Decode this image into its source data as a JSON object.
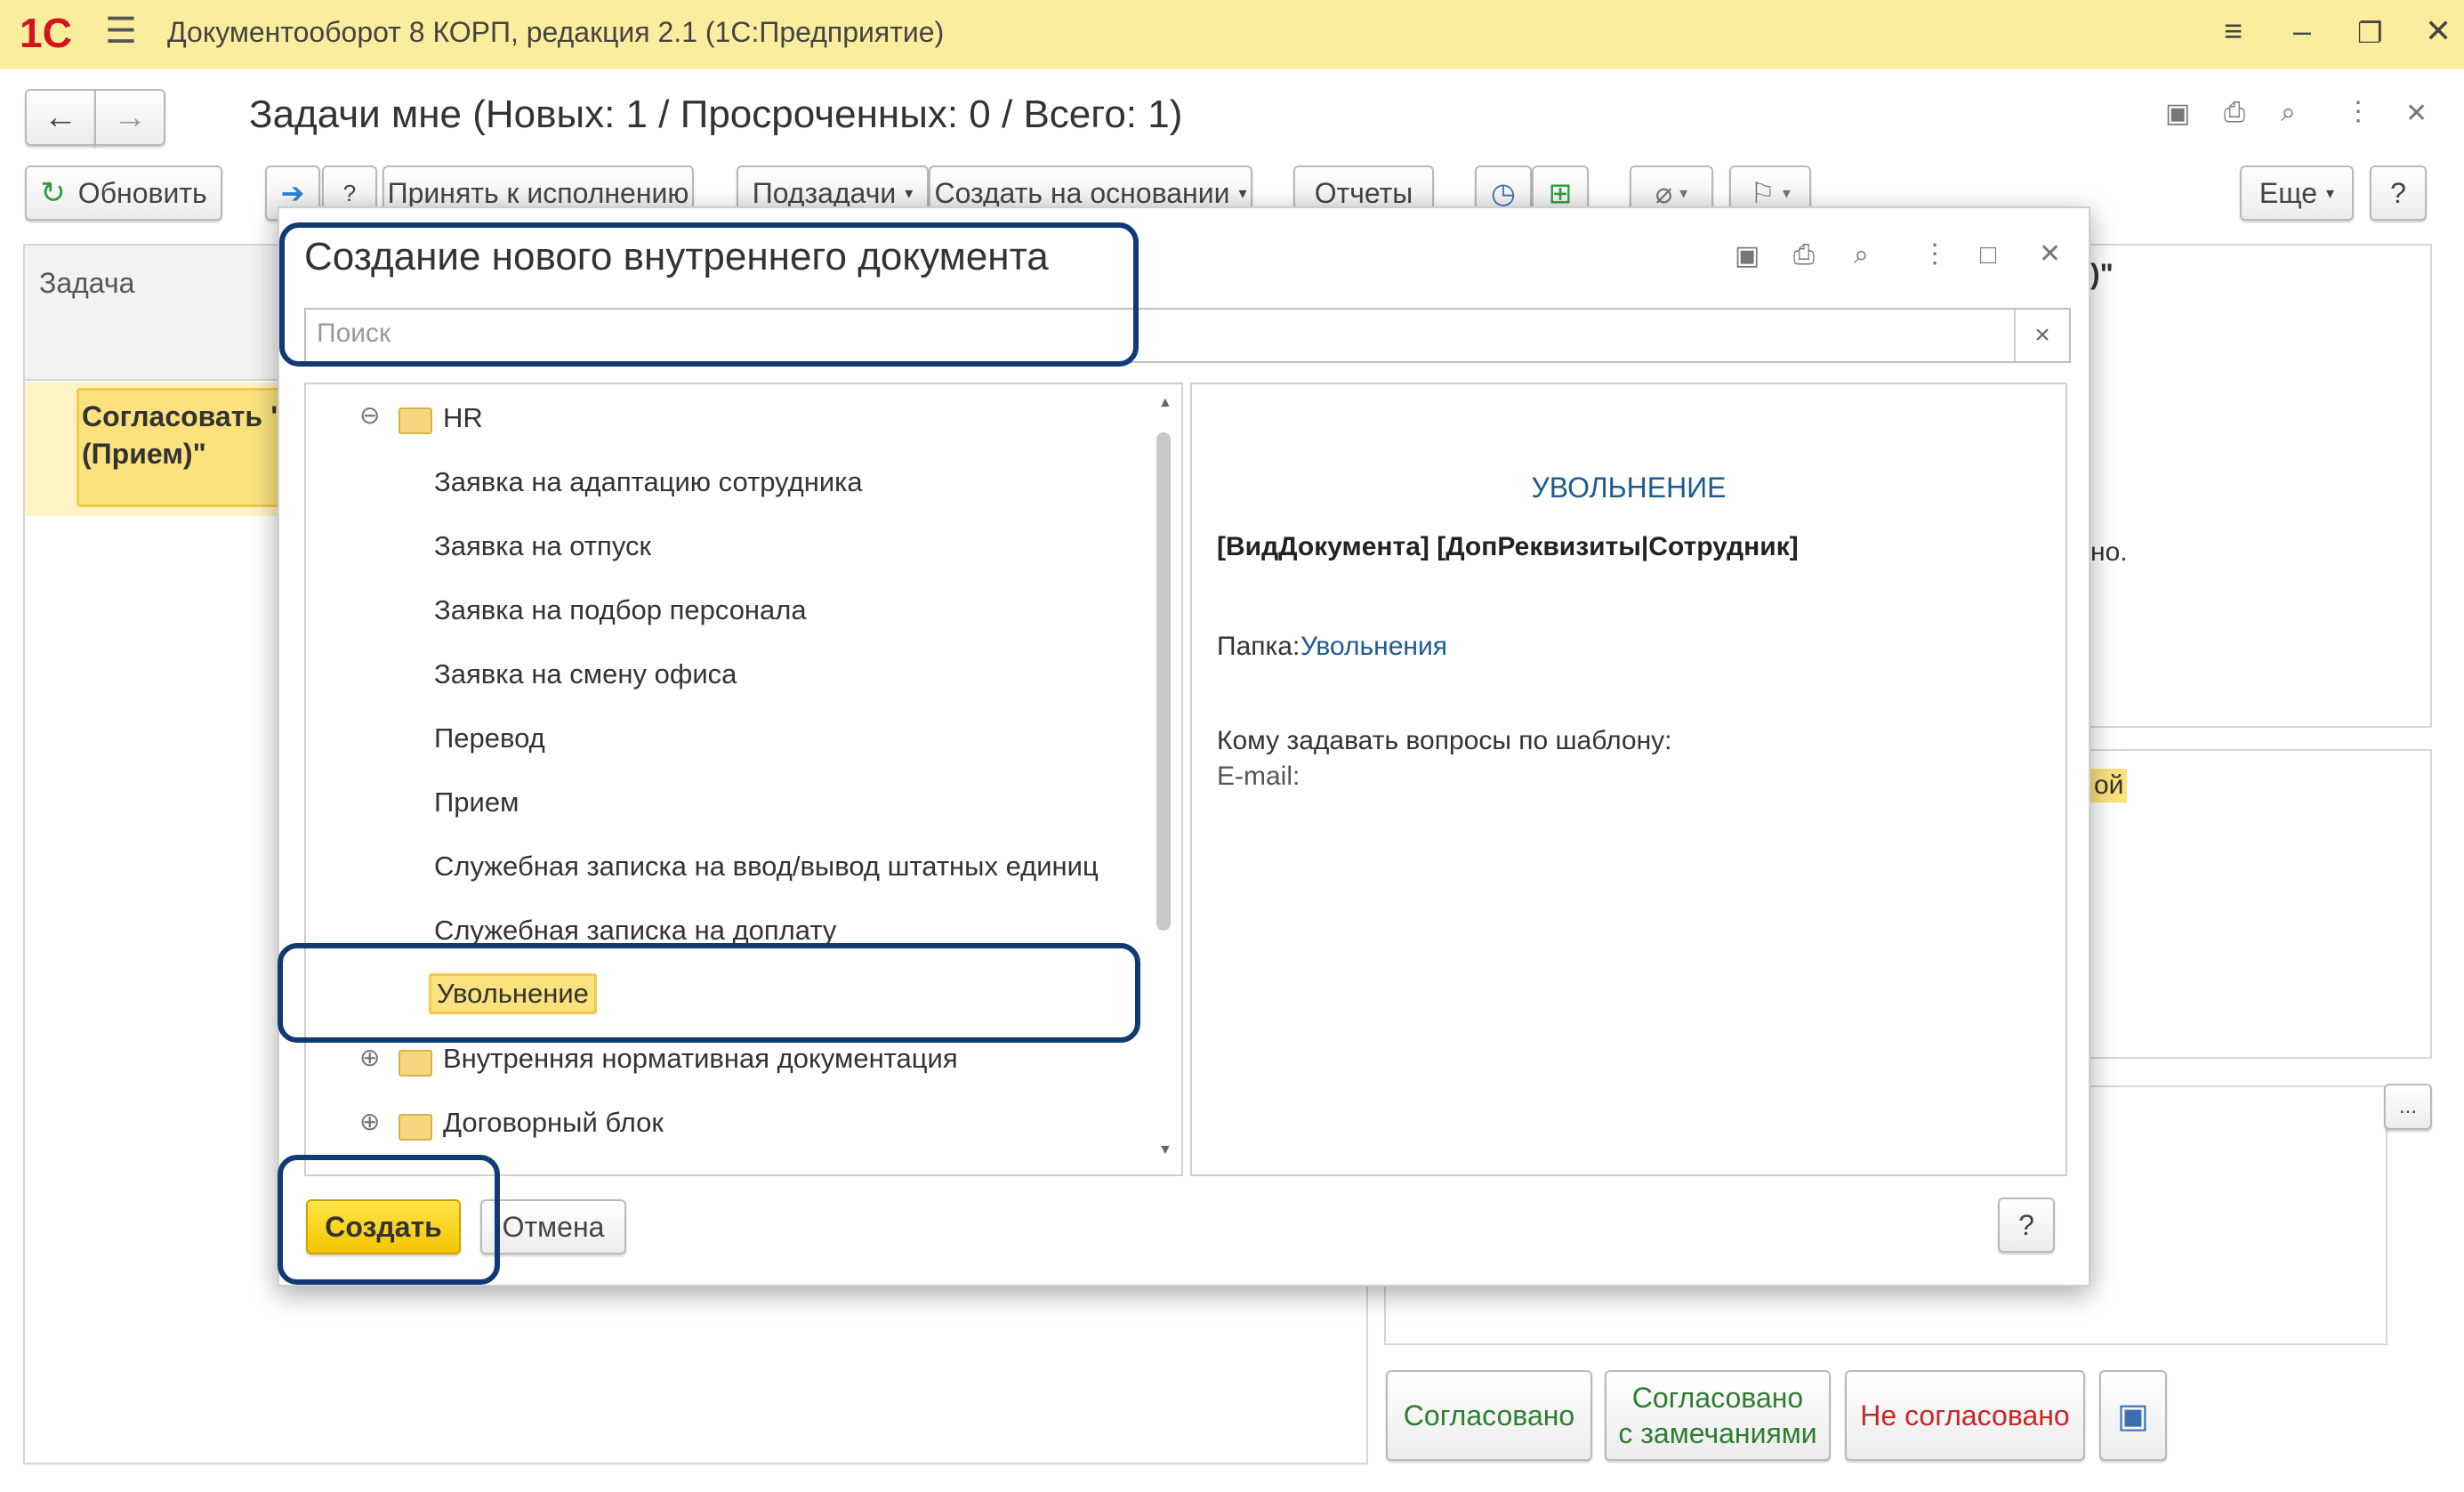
{
  "window": {
    "logo": "1С",
    "title": "Документооборот 8 КОРП, редакция 2.1  (1С:Предприятие)"
  },
  "page": {
    "title": "Задачи мне (Новых: 1 / Просроченных: 0 / Всего: 1)"
  },
  "toolbar": {
    "refresh": "Обновить",
    "accept": "Принять к исполнению",
    "subtasks": "Подзадачи",
    "create_based_on": "Создать на основании",
    "reports": "Отчеты",
    "more": "Еще",
    "help": "?"
  },
  "task_list": {
    "column_header": "Задача",
    "selected_task_line1": "Согласовать \"П",
    "selected_task_line2": "(Прием)\""
  },
  "right_panel": {
    "fragment1": ")\"",
    "fragment2": "но.",
    "fragment3": "ой",
    "ellipsis": "...",
    "approved": "Согласовано",
    "approved_with_remarks_line1": "Согласовано",
    "approved_with_remarks_line2": "с замечаниями",
    "not_approved": "Не согласовано"
  },
  "dialog": {
    "title": "Создание нового внутреннего документа",
    "search_placeholder": "Поиск",
    "search_clear": "×",
    "tree": {
      "hr_folder": "HR",
      "items": [
        "Заявка на адаптацию сотрудника",
        "Заявка на отпуск",
        "Заявка на подбор персонала",
        "Заявка на смену офиса",
        "Перевод",
        "Прием",
        "Служебная записка на ввод/вывод штатных единиц",
        "Служебная записка на доплату"
      ],
      "selected_item": "Увольнение",
      "other_folders": [
        "Внутренняя нормативная документация",
        "Договорный блок"
      ]
    },
    "preview": {
      "heading": "УВОЛЬНЕНИЕ",
      "template": "[ВидДокумента] [ДопРеквизиты|Сотрудник]",
      "folder_label": "Папка:",
      "folder_value": "Увольнения",
      "questions_label": "Кому задавать вопросы по шаблону:",
      "email_label": "E-mail:"
    },
    "create_button": "Создать",
    "cancel_button": "Отмена",
    "help_button": "?"
  },
  "colors": {
    "titlebar": "#fbed9e",
    "selection": "#fbe27d",
    "accent_blue": "#1d5a8e",
    "annotation_frame": "#0f3a74",
    "approved_text": "#2e7d32",
    "not_approved_text": "#c62828"
  }
}
